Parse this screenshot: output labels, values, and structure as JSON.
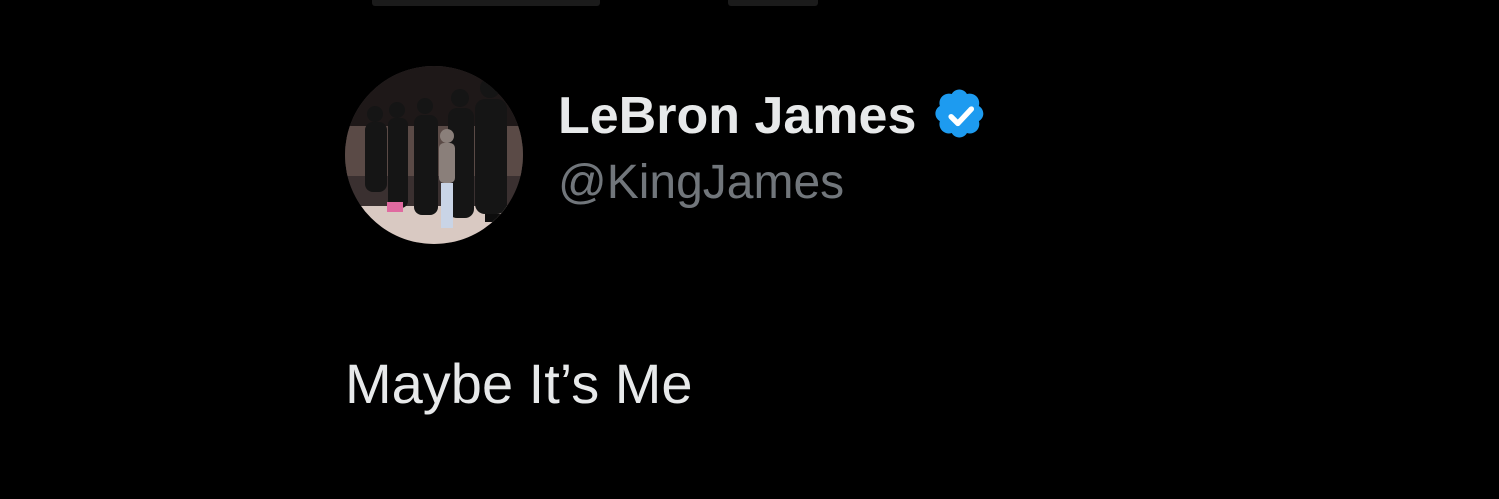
{
  "tweet": {
    "author": {
      "display_name": "LeBron James",
      "handle": "@KingJames",
      "verified_icon": "verified-badge-icon",
      "avatar": "profile-photo"
    },
    "text": "Maybe It’s Me"
  },
  "colors": {
    "background": "#000000",
    "primary_text": "#e7e9ea",
    "secondary_text": "#71767b",
    "verified_blue": "#1d9bf0"
  }
}
